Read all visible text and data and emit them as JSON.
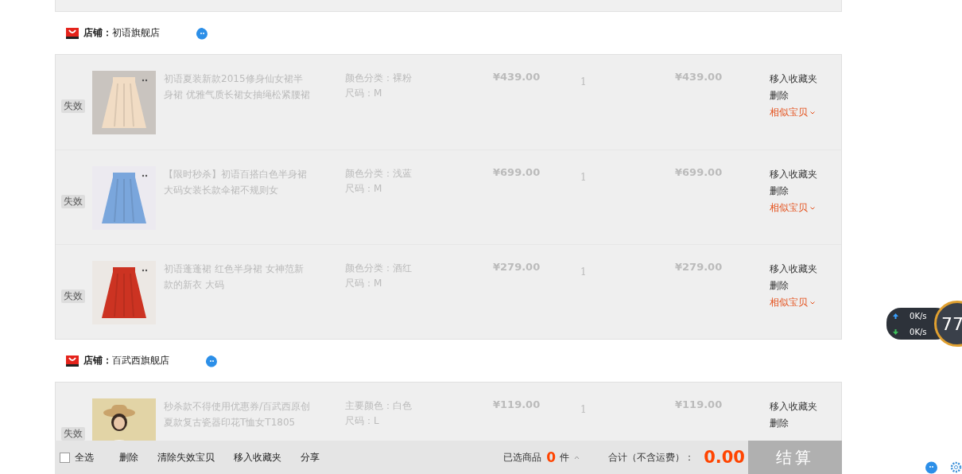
{
  "stores": [
    {
      "title": "**店铺：**初语旗舰店",
      "items": [
        {
          "status": "失效",
          "title": "初语夏装新款2015修身仙女裙半身裙 优雅气质长裙女抽绳松紧腰裙",
          "attrs": [
            "颜色分类：裸粉",
            "尺码：M"
          ],
          "price": "¥439.00",
          "qty": "1",
          "subtotal": "¥439.00",
          "actions": [
            "移入收藏夹",
            "删除"
          ],
          "similar": "相似宝贝"
        },
        {
          "status": "失效",
          "title": "【限时秒杀】初语百搭白色半身裙大码女装长款伞裙不规则女",
          "attrs": [
            "颜色分类：浅蓝",
            "尺码：M"
          ],
          "price": "¥699.00",
          "qty": "1",
          "subtotal": "¥699.00",
          "actions": [
            "移入收藏夹",
            "删除"
          ],
          "similar": "相似宝贝"
        },
        {
          "status": "失效",
          "title": "初语蓬蓬裙 红色半身裙 女神范新款的新衣 大码",
          "attrs": [
            "颜色分类：酒红",
            "尺码：M"
          ],
          "price": "¥279.00",
          "qty": "1",
          "subtotal": "¥279.00",
          "actions": [
            "移入收藏夹",
            "删除"
          ],
          "similar": "相似宝贝"
        }
      ]
    },
    {
      "title": "**店铺：**百武西旗舰店",
      "items": [
        {
          "status": "失效",
          "title": "秒杀款不得使用优惠券/百武西原创夏款复古瓷器印花T恤女T1805",
          "attrs": [
            "主要颜色：白色",
            "尺码：L"
          ],
          "price": "¥119.00",
          "qty": "1",
          "subtotal": "¥119.00",
          "actions": [
            "移入收藏夹",
            "删除"
          ]
        }
      ]
    }
  ],
  "footer": {
    "select_all": {
      "label": "全选",
      "checked": false
    },
    "actions": [
      "删除",
      "清除失效宝贝",
      "移入收藏夹",
      "分享"
    ],
    "selected_label": "已选商品",
    "selected_count": "0",
    "selected_unit": "件",
    "total_label": "合计（不含运费）：",
    "total": "0.00",
    "checkout": "结算"
  },
  "speed_widget": {
    "up": "0",
    "up_unit": "K/s",
    "down": "0",
    "down_unit": "K/s",
    "score": "77"
  }
}
